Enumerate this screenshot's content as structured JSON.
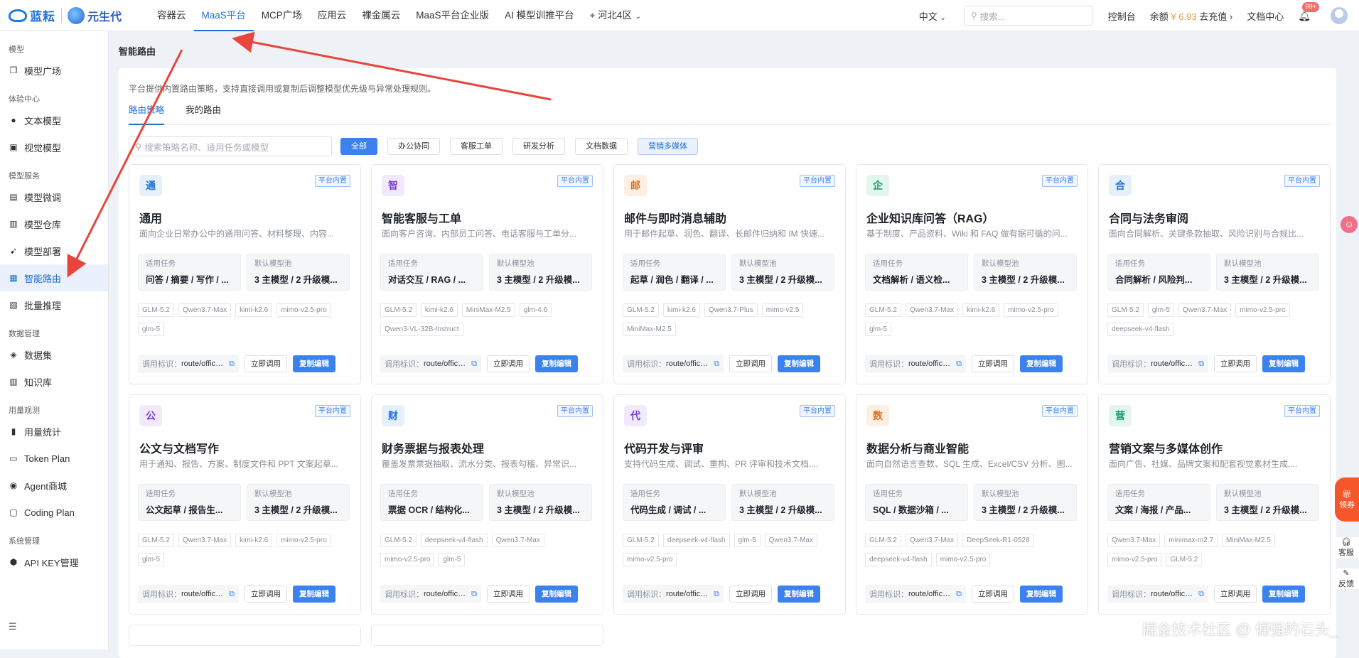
{
  "brand": {
    "logo1_text": "蓝耘",
    "logo2_text": "元生代"
  },
  "nav": [
    {
      "label": "容器云"
    },
    {
      "label": "MaaS平台",
      "active": true
    },
    {
      "label": "MCP广场"
    },
    {
      "label": "应用云"
    },
    {
      "label": "裸金属云"
    },
    {
      "label": "MaaS平台企业版"
    },
    {
      "label": "AI 模型训推平台"
    },
    {
      "label": "河北4区",
      "location": true
    }
  ],
  "topright": {
    "lang": "中文",
    "search_placeholder": "搜索...",
    "console": "控制台",
    "balance_label": "余额",
    "balance_amount": "¥ 6.93",
    "recharge": "去充值",
    "docs": "文档中心",
    "notif_badge": "99+"
  },
  "sidebar": {
    "groups": [
      {
        "title": "模型",
        "items": [
          {
            "label": "模型广场",
            "icon": "cube-icon"
          }
        ]
      },
      {
        "title": "体验中心",
        "items": [
          {
            "label": "文本模型",
            "icon": "chat-icon"
          },
          {
            "label": "视觉模型",
            "icon": "camera-icon"
          }
        ]
      },
      {
        "title": "模型服务",
        "items": [
          {
            "label": "模型微调",
            "icon": "tune-icon"
          },
          {
            "label": "模型仓库",
            "icon": "storage-icon"
          },
          {
            "label": "模型部署",
            "icon": "rocket-icon"
          },
          {
            "label": "智能路由",
            "icon": "route-icon",
            "active": true
          },
          {
            "label": "批量推理",
            "icon": "batch-icon"
          }
        ]
      },
      {
        "title": "数据管理",
        "items": [
          {
            "label": "数据集",
            "icon": "dataset-icon"
          },
          {
            "label": "知识库",
            "icon": "book-icon"
          }
        ]
      },
      {
        "title": "用量观测",
        "items": [
          {
            "label": "用量统计",
            "icon": "bar-chart-icon"
          },
          {
            "label": "Token Plan",
            "icon": "plan-icon"
          },
          {
            "label": "Agent商城",
            "icon": "agent-icon"
          },
          {
            "label": "Coding Plan",
            "icon": "code-icon"
          }
        ]
      },
      {
        "title": "系统管理",
        "items": [
          {
            "label": "API KEY管理",
            "icon": "key-icon"
          }
        ]
      }
    ]
  },
  "page": {
    "title": "智能路由",
    "description": "平台提供内置路由策略，支持直接调用或复制后调整模型优先级与异常处理规则。",
    "tabs": [
      {
        "label": "路由策略",
        "active": true
      },
      {
        "label": "我的路由"
      }
    ],
    "search_placeholder": "搜索策略名称、适用任务或模型",
    "filters": [
      {
        "label": "全部",
        "style": "primary"
      },
      {
        "label": "办公协同"
      },
      {
        "label": "客服工单"
      },
      {
        "label": "研发分析"
      },
      {
        "label": "文档数据"
      },
      {
        "label": "营销多媒体",
        "style": "selected"
      }
    ]
  },
  "card_labels": {
    "badge": "平台内置",
    "task_label": "适用任务",
    "pool_label": "默认模型池",
    "route_label": "调用标识：",
    "invoke": "立即调用",
    "copy_edit": "复制编辑"
  },
  "cards": [
    {
      "icon_char": "通",
      "icon_color": "#1f6fd6",
      "icon_bg": "#e6f0fd",
      "title": "通用",
      "desc": "面向企业日常办公中的通用问答、材料整理、内容...",
      "task": "问答 / 摘要 / 写作 / ...",
      "pool": "3 主模型 / 2 升级模...",
      "tags": [
        "GLM-5.2",
        "Qwen3.7-Max",
        "kimi-k2.6",
        "mimo-v2.5-pro",
        "glm-5"
      ],
      "route": "route/office/g..."
    },
    {
      "icon_char": "智",
      "icon_color": "#7b3fd0",
      "icon_bg": "#f1e9fc",
      "title": "智能客服与工单",
      "desc": "面向客户咨询、内部员工问答、电话客服与工单分...",
      "task": "对话交互 / RAG / ...",
      "pool": "3 主模型 / 2 升级模...",
      "tags": [
        "GLM-5.2",
        "kimi-k2.6",
        "MiniMax-M2.5",
        "glm-4.6",
        "Qwen3-VL-32B-Instruct"
      ],
      "route": "route/office/c..."
    },
    {
      "icon_char": "邮",
      "icon_color": "#e0701e",
      "icon_bg": "#fdefe3",
      "title": "邮件与即时消息辅助",
      "desc": "用于邮件起草、润色、翻译、长邮件归纳和 IM 快速...",
      "task": "起草 / 润色 / 翻译 / ...",
      "pool": "3 主模型 / 2 升级模...",
      "tags": [
        "GLM-5.2",
        "kimi-k2.6",
        "Qwen3.7-Plus",
        "mimo-v2.5",
        "MiniMax-M2.5"
      ],
      "route": "route/office/..."
    },
    {
      "icon_char": "企",
      "icon_color": "#1a9a6b",
      "icon_bg": "#e3f6ee",
      "title": "企业知识库问答（RAG）",
      "desc": "基于制度、产品资料、Wiki 和 FAQ 做有据可循的问...",
      "task": "文档解析 / 语义检...",
      "pool": "3 主模型 / 2 升级模...",
      "tags": [
        "GLM-5.2",
        "Qwen3.7-Max",
        "kimi-k2.6",
        "mimo-v2.5-pro",
        "glm-5"
      ],
      "route": "route/office/r..."
    },
    {
      "icon_char": "合",
      "icon_color": "#1f6fd6",
      "icon_bg": "#e6f0fd",
      "title": "合同与法务审阅",
      "desc": "面向合同解析、关键条款抽取、风险识别与合规比...",
      "task": "合同解析 / 风险判...",
      "pool": "3 主模型 / 2 升级模...",
      "tags": [
        "GLM-5.2",
        "glm-5",
        "Qwen3.7-Max",
        "mimo-v2.5-pro",
        "deepseek-v4-flash"
      ],
      "route": "route/office/l..."
    },
    {
      "icon_char": "公",
      "icon_color": "#7b3fd0",
      "icon_bg": "#f1e9fc",
      "title": "公文与文档写作",
      "desc": "用于通知、报告、方案、制度文件和 PPT 文案起草...",
      "task": "公文起草 / 报告生...",
      "pool": "3 主模型 / 2 升级模...",
      "tags": [
        "GLM-5.2",
        "Qwen3.7-Max",
        "kimi-k2.6",
        "mimo-v2.5-pro",
        "glm-5"
      ],
      "route": "route/office/d..."
    },
    {
      "icon_char": "财",
      "icon_color": "#1f6fd6",
      "icon_bg": "#e6f0fd",
      "title": "财务票据与报表处理",
      "desc": "覆盖发票票据抽取、流水分类、报表勾稽、异常识...",
      "task": "票据 OCR / 结构化...",
      "pool": "3 主模型 / 2 升级模...",
      "tags": [
        "GLM-5.2",
        "deepseek-v4-flash",
        "Qwen3.7-Max",
        "mimo-v2.5-pro",
        "glm-5"
      ],
      "route": "route/office/fi..."
    },
    {
      "icon_char": "代",
      "icon_color": "#7b3fd0",
      "icon_bg": "#f1e9fc",
      "title": "代码开发与评审",
      "desc": "支持代码生成、调试、重构、PR 评审和技术文档,...",
      "task": "代码生成 / 调试 / ...",
      "pool": "3 主模型 / 2 升级模...",
      "tags": [
        "GLM-5.2",
        "deepseek-v4-flash",
        "glm-5",
        "Qwen3.7-Max",
        "mimo-v2.5-pro"
      ],
      "route": "route/office/c..."
    },
    {
      "icon_char": "数",
      "icon_color": "#e0701e",
      "icon_bg": "#fdefe3",
      "title": "数据分析与商业智能",
      "desc": "面向自然语言查数、SQL 生成、Excel/CSV 分析、图...",
      "task": "SQL / 数据沙箱 / ...",
      "pool": "3 主模型 / 2 升级模...",
      "tags": [
        "GLM-5.2",
        "Qwen3.7-Max",
        "DeepSeek-R1-0528",
        "deepseek-v4-flash",
        "mimo-v2.5-pro"
      ],
      "route": "route/office/b..."
    },
    {
      "icon_char": "营",
      "icon_color": "#1a9a6b",
      "icon_bg": "#e3f6ee",
      "title": "营销文案与多媒体创作",
      "desc": "面向广告、社媒、品牌文案和配套视觉素材生成,...",
      "task": "文案 / 海报 / 产品...",
      "pool": "3 主模型 / 2 升级模...",
      "tags": [
        "Qwen3.7-Max",
        "minimax-m2.7",
        "MiniMax-M2.5",
        "mimo-v2.5-pro",
        "GLM-5.2"
      ],
      "route": "route/office/..."
    }
  ],
  "floating": {
    "coupon": "领券",
    "service": "客服",
    "feedback": "反馈"
  },
  "watermark": "掘金技术社区 @ 倔强的石头_"
}
